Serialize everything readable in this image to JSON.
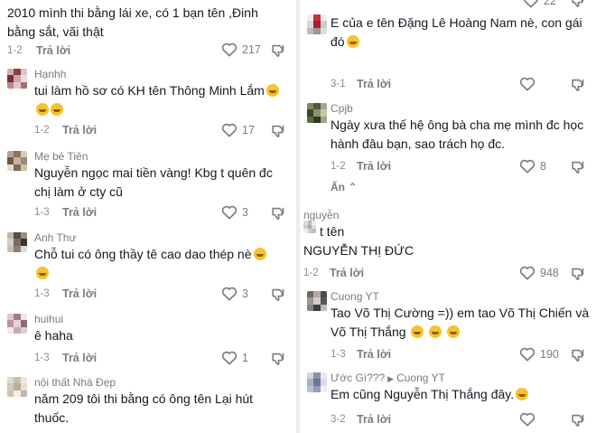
{
  "left": {
    "comments": [
      {
        "lines": [
          "2010 mình thi bằng lái xe, có 1 bạn tên ,Đinh",
          "bằng sắt, vãi thật"
        ],
        "date": "1-2",
        "reply": "Trả lời",
        "likes": "217"
      },
      {
        "author": "Hạnhh",
        "lines": [
          "tui làm hồ sơ có KH tên Thông Minh Lắm",
          ""
        ],
        "date": "1-2",
        "reply": "Trả lời",
        "likes": "17"
      },
      {
        "author": "Mẹ bé Tiên",
        "lines": [
          "Nguyễn ngọc mai tiền vàng! Kbg t quên đc",
          "chị làm ở cty cũ"
        ],
        "date": "1-3",
        "reply": "Trả lời",
        "likes": "3"
      },
      {
        "author": "Anh Thư",
        "lines": [
          "Chỗ tui có ông thầy tê cao dao thép nè",
          ""
        ],
        "date": "1-3",
        "reply": "Trả lời",
        "likes": "3"
      },
      {
        "author": "huihui",
        "lines": [
          "ê haha"
        ],
        "date": "1-3",
        "reply": "Trả lời",
        "likes": "1"
      },
      {
        "author": "nội thất Nhà Đẹp",
        "lines": [
          "năm 209 tôi thi bằng có ông tên Lại hút",
          "thuốc."
        ]
      }
    ]
  },
  "right": {
    "top_likes": "22",
    "comments": [
      {
        "lines": [
          "E của e tên Đặng Lê Hoàng Nam nè, con gái",
          "đó"
        ],
        "date": "3-1",
        "reply": "Trả lời"
      },
      {
        "author": "Cpjb",
        "lines": [
          "Ngày xưa thế hệ ông bà cha mẹ mình đc học",
          "hành đâu bạn, sao trách họ đc."
        ],
        "date": "1-2",
        "reply": "Trả lời",
        "likes": "8",
        "hide": "Ẩn"
      },
      {
        "author": "nguyễn",
        "lines": [
          "t tên",
          "NGUYỄN THỊ ĐỨC"
        ],
        "date": "1-2",
        "reply": "Trả lời",
        "likes": "948"
      },
      {
        "author": "Cuong YT",
        "lines": [
          "Tao Võ Thị Cường =)) em tao Võ Thị Chiến và",
          "Võ Thị Thắng"
        ],
        "date": "1-3",
        "reply": "Trả lời",
        "likes": "190"
      },
      {
        "author": "Ước Gì???",
        "reply_to": "Cuong YT",
        "lines": [
          "Em cũng Nguyễn Thị Thắng đây."
        ],
        "date": "3-2",
        "reply": "Trả lời"
      }
    ]
  },
  "icons": {
    "like": "heart-outline-icon",
    "dislike": "thumbs-down-icon",
    "reply_arrow": "caret-right-icon",
    "hide_chevron": "chevron-up-icon"
  },
  "colors": {
    "text": "#161823",
    "meta": "#8a8b91",
    "icon": "#7a7b80",
    "emoji": "#f6c32c"
  }
}
